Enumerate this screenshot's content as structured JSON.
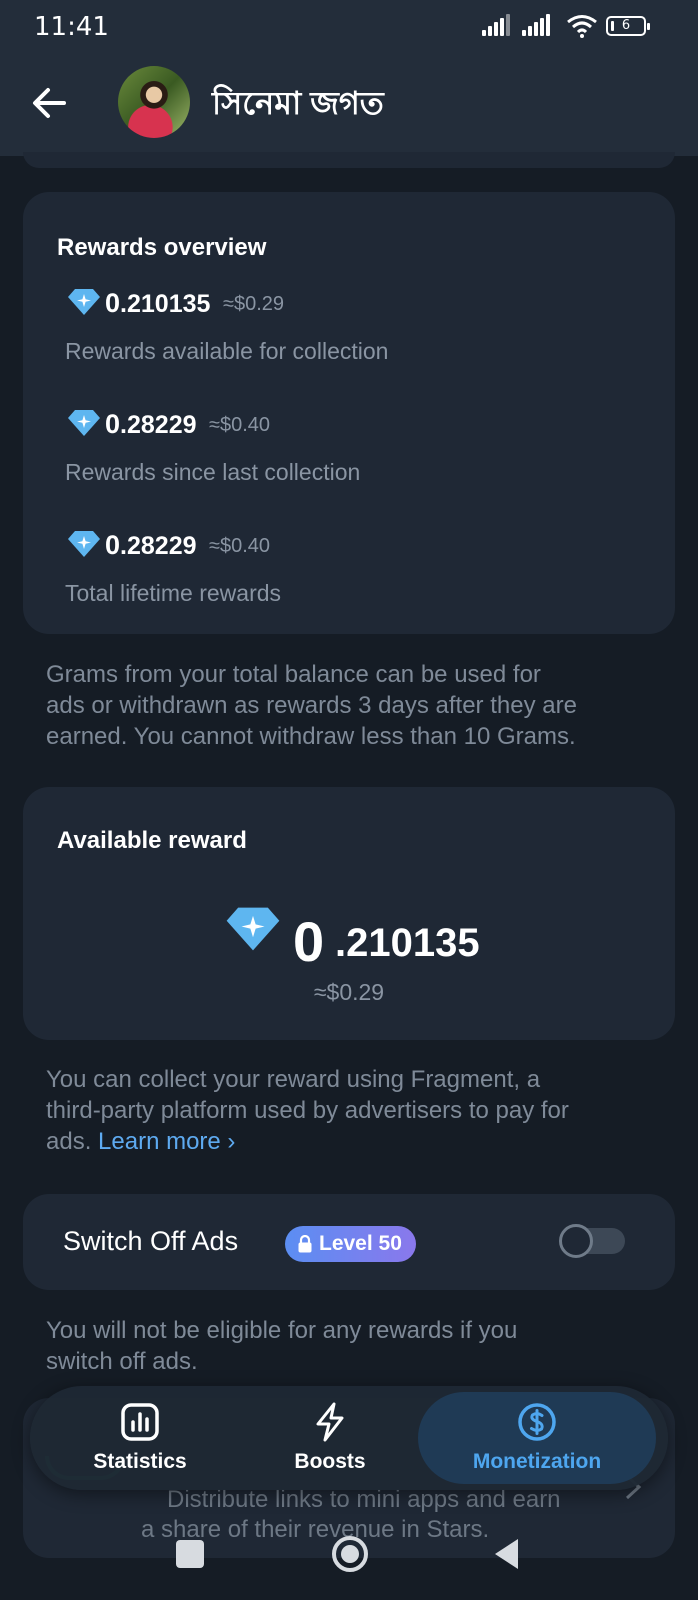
{
  "status_bar": {
    "time": "11:41",
    "battery": "6"
  },
  "header": {
    "title": "সিনেমা জগত"
  },
  "rewards_overview": {
    "title": "Rewards overview",
    "items": [
      {
        "amount_int": "0",
        "amount_dec": ".210135",
        "usd": "≈$0.29",
        "label": "Rewards available for collection"
      },
      {
        "amount_int": "0",
        "amount_dec": ".28229",
        "usd": "≈$0.40",
        "label": "Rewards since last collection"
      },
      {
        "amount_int": "0",
        "amount_dec": ".28229",
        "usd": "≈$0.40",
        "label": "Total lifetime rewards"
      }
    ]
  },
  "grams_note": {
    "line1": "Grams from your total balance can be used for",
    "line2": "ads or withdrawn as rewards 3 days after they are",
    "line3": "earned. You cannot withdraw less than 10 Grams."
  },
  "available_reward": {
    "title": "Available reward",
    "amount_int": "0",
    "amount_dec": ".210135",
    "usd": "≈$0.29"
  },
  "collect_note": {
    "line1": "You can collect your reward using Fragment, a",
    "line2": "third-party platform used by advertisers to pay for",
    "line3_prefix": "ads. ",
    "link": "Learn more ›"
  },
  "switch_off_ads": {
    "label": "Switch Off Ads",
    "badge": "Level 50",
    "enabled": false
  },
  "ads_note": {
    "line1": "You will not be eligible for any rewards if you",
    "line2": "switch off ads."
  },
  "hidden_card": {
    "line1": "Distribute links to mini apps and earn",
    "line2": "a share of their revenue in Stars."
  },
  "tabs": [
    {
      "label": "Statistics",
      "icon": "bar-chart-icon",
      "active": false
    },
    {
      "label": "Boosts",
      "icon": "lightning-icon",
      "active": false
    },
    {
      "label": "Monetization",
      "icon": "dollar-circle-icon",
      "active": true
    }
  ],
  "colors": {
    "accent": "#4ea6ef",
    "card": "#1f2835",
    "background": "#151c25",
    "gem": "#5eb6f0"
  }
}
